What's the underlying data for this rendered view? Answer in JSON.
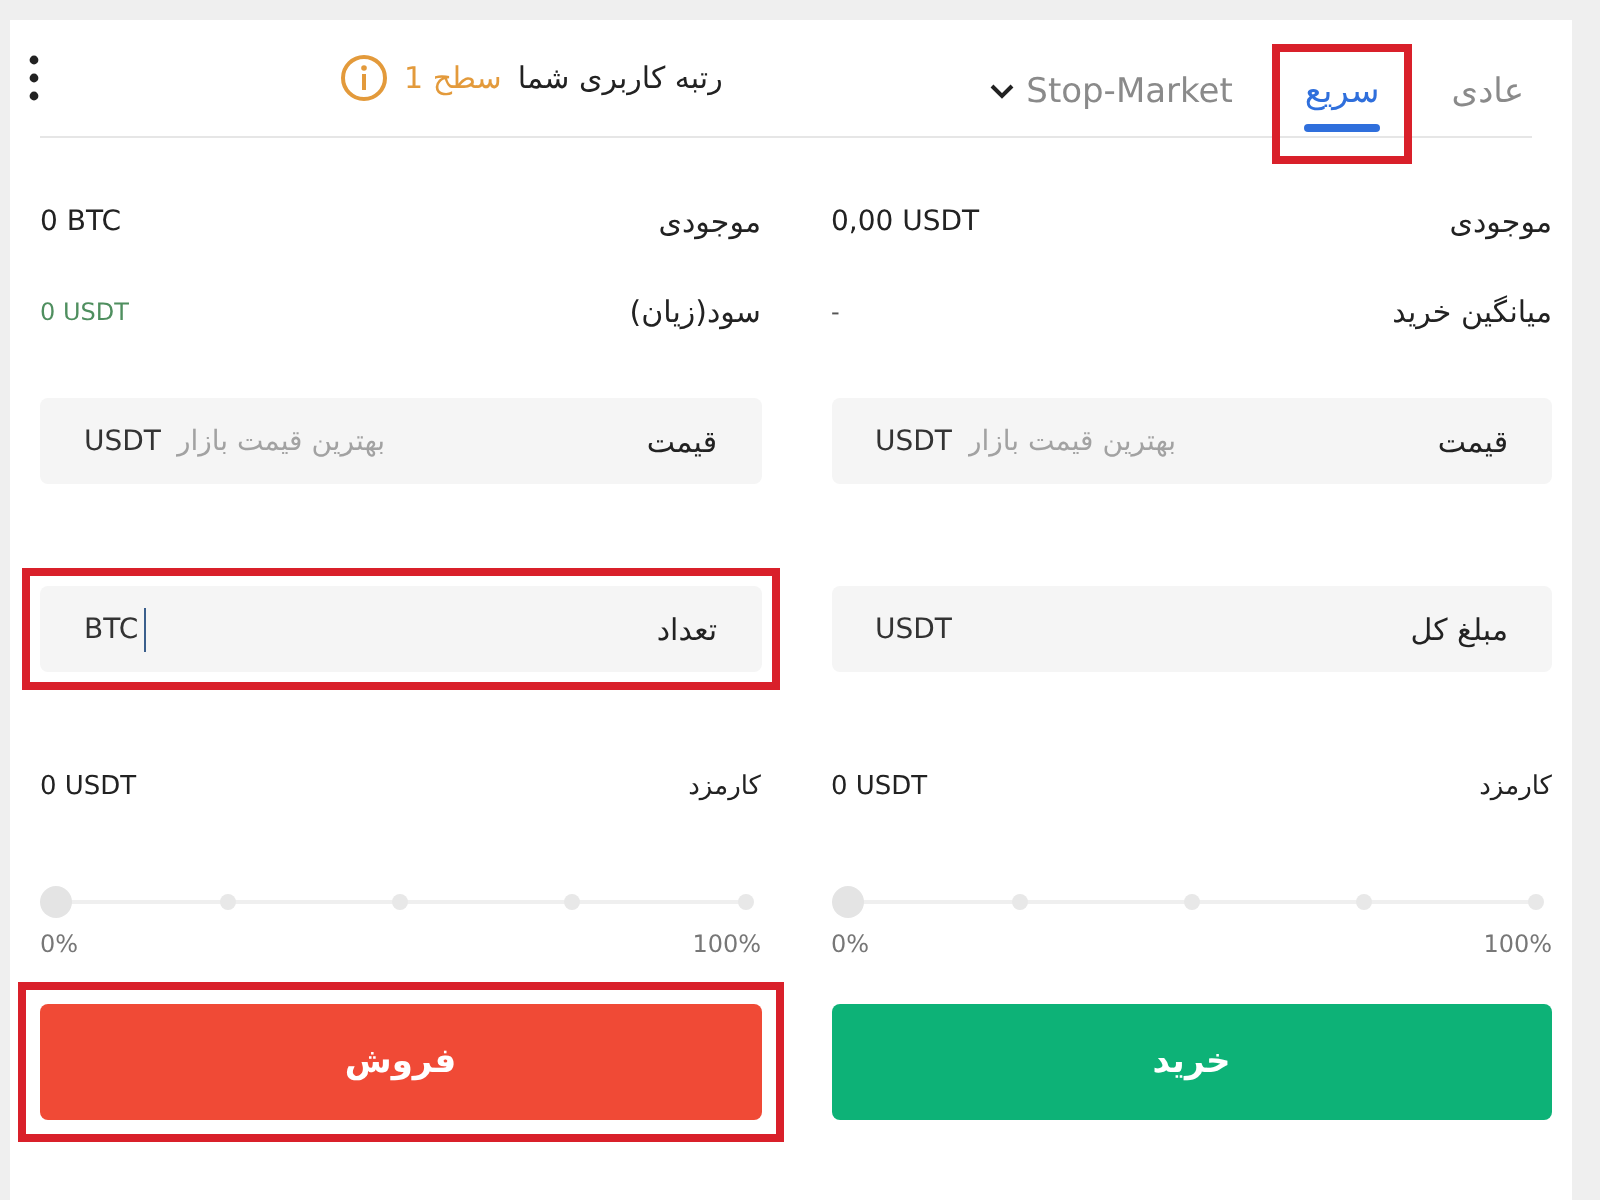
{
  "header": {
    "tabs": [
      {
        "label": "عادی",
        "kind": "plain",
        "selected": false,
        "highlighted": false
      },
      {
        "label": "سریع",
        "kind": "plain",
        "selected": true,
        "highlighted": true
      },
      {
        "label": "Stop-Market",
        "kind": "dropdown",
        "selected": false,
        "highlighted": false
      }
    ],
    "user_level": {
      "label": "رتبه کاربری شما",
      "value": "سطح 1"
    }
  },
  "columns": [
    {
      "info": [
        {
          "label": "موجودی",
          "value": "0,00 USDT",
          "kind": "plain"
        },
        {
          "label": "میانگین خرید",
          "value": "-",
          "kind": "plain"
        }
      ],
      "fields": [
        {
          "label": "قیمت",
          "placeholder": "بهترین قیمت بازار",
          "unit": "USDT",
          "focused": false,
          "highlighted": false
        },
        {
          "label": "مبلغ کل",
          "unit": "USDT",
          "focused": false,
          "highlighted": false
        }
      ],
      "fee": {
        "label": "کارمزد",
        "value": "0 USDT"
      },
      "slider": {
        "level": 0,
        "min_label": "0%",
        "max_label": "100%"
      },
      "button": {
        "label": "خرید",
        "kind": "buy",
        "highlighted": false
      }
    },
    {
      "info": [
        {
          "label": "موجودی",
          "value": "0 BTC",
          "kind": "plain"
        },
        {
          "label": "سود(زیان)",
          "value": "0 USDT",
          "kind": "pnl"
        }
      ],
      "fields": [
        {
          "label": "قیمت",
          "placeholder": "بهترین قیمت بازار",
          "unit": "USDT",
          "focused": false,
          "highlighted": false
        },
        {
          "label": "تعداد",
          "unit": "BTC",
          "focused": true,
          "highlighted": true
        }
      ],
      "fee": {
        "label": "کارمزد",
        "value": "0 USDT"
      },
      "slider": {
        "level": 0,
        "min_label": "0%",
        "max_label": "100%"
      },
      "button": {
        "label": "فروش",
        "kind": "sell",
        "highlighted": true
      }
    }
  ]
}
